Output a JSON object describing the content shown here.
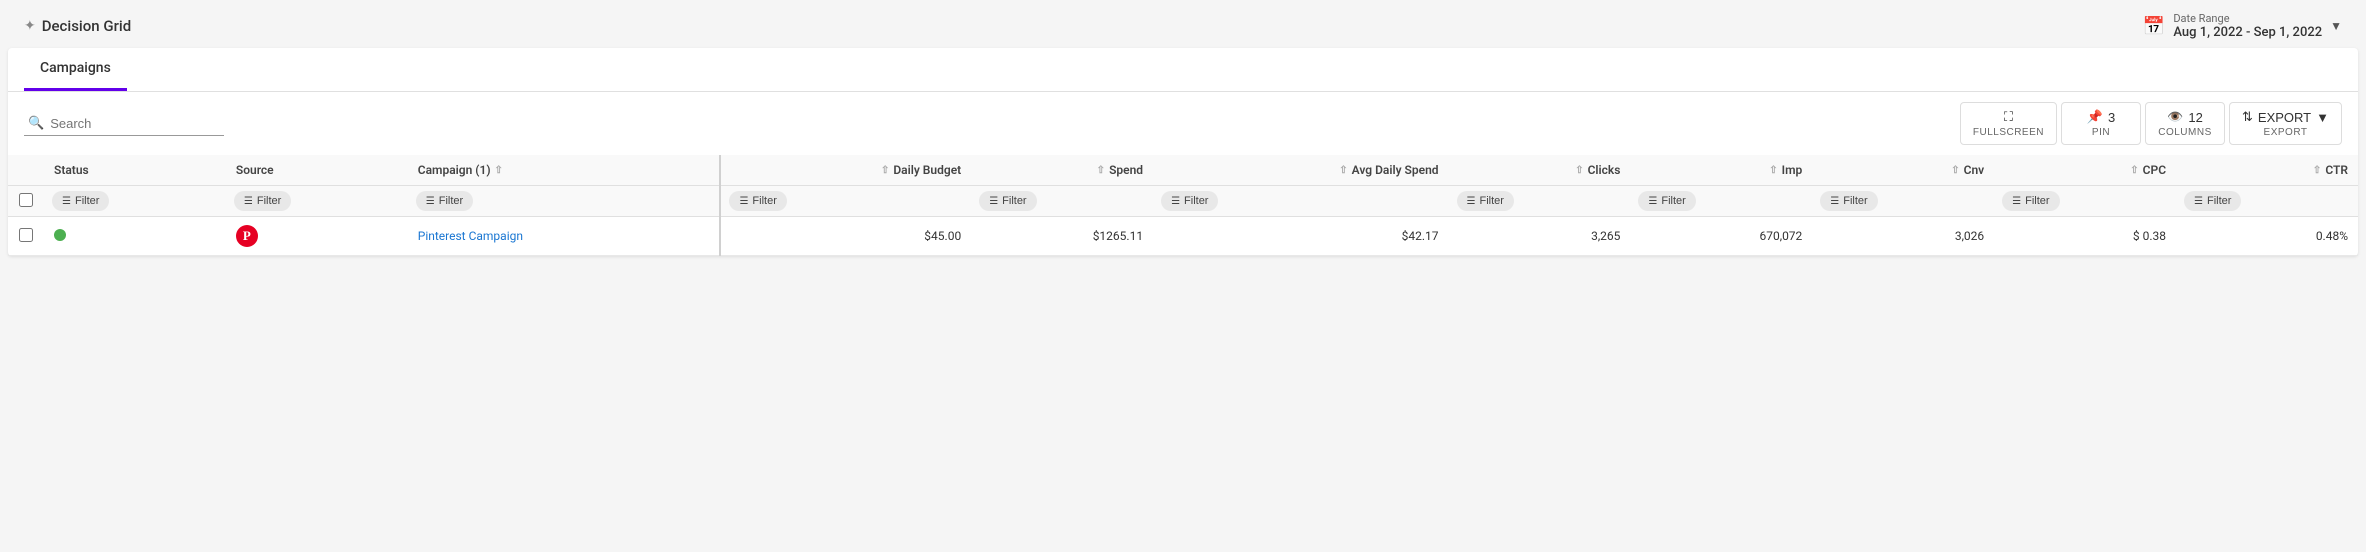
{
  "app": {
    "title": "Decision Grid",
    "sparkle": "✦"
  },
  "date_range": {
    "label": "Date Range",
    "value": "Aug 1, 2022 - Sep 1, 2022"
  },
  "tabs": [
    {
      "label": "Campaigns",
      "active": true
    }
  ],
  "toolbar": {
    "search_placeholder": "Search",
    "fullscreen_label": "FULLSCREEN",
    "pin_count": "3",
    "pin_label": "PIN",
    "columns_count": "12",
    "columns_label": "COLUMNS",
    "export_label": "EXPORT",
    "export_btn_label": "EXPORT"
  },
  "table": {
    "columns": [
      {
        "key": "checkbox",
        "label": ""
      },
      {
        "key": "status",
        "label": "Status"
      },
      {
        "key": "source",
        "label": "Source"
      },
      {
        "key": "campaign",
        "label": "Campaign (1)",
        "sortable": true
      },
      {
        "key": "daily_budget",
        "label": "Daily Budget",
        "right": true
      },
      {
        "key": "spend",
        "label": "Spend",
        "right": true
      },
      {
        "key": "avg_daily_spend",
        "label": "Avg Daily Spend",
        "right": true
      },
      {
        "key": "clicks",
        "label": "Clicks",
        "right": true
      },
      {
        "key": "imp",
        "label": "Imp",
        "right": true
      },
      {
        "key": "cnv",
        "label": "Cnv",
        "right": true
      },
      {
        "key": "cpc",
        "label": "CPC",
        "right": true
      },
      {
        "key": "ctr",
        "label": "CTR",
        "right": true
      }
    ],
    "rows": [
      {
        "status": "active",
        "source": "pinterest",
        "campaign": "Pinterest Campaign",
        "daily_budget": "$45.00",
        "spend": "$1265.11",
        "avg_daily_spend": "$42.17",
        "clicks": "3,265",
        "imp": "670,072",
        "cnv": "3,026",
        "cpc": "$ 0.38",
        "ctr": "0.48%"
      }
    ]
  }
}
